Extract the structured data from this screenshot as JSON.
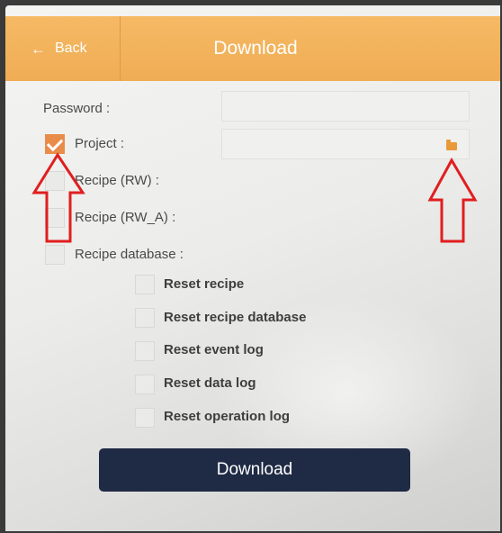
{
  "header": {
    "back_label": "Back",
    "back_icon": "arrow-left-icon",
    "title": "Download"
  },
  "form": {
    "password_label": "Password :",
    "password_value": "",
    "project_label": "Project :",
    "project_checked": true,
    "project_path": "",
    "project_icon": "folder-icon",
    "options": [
      {
        "label": "Recipe (RW) :",
        "checked": false
      },
      {
        "label": "Recipe (RW_A) :",
        "checked": false
      },
      {
        "label": "Recipe database :",
        "checked": false
      }
    ],
    "reset_options": [
      {
        "label": "Reset recipe",
        "checked": false
      },
      {
        "label": "Reset recipe database",
        "checked": false
      },
      {
        "label": "Reset event log",
        "checked": false
      },
      {
        "label": "Reset data log",
        "checked": false
      },
      {
        "label": "Reset operation log",
        "checked": false
      }
    ]
  },
  "actions": {
    "download_label": "Download"
  },
  "colors": {
    "header": "#f0ae57",
    "checked": "#e98c4a",
    "button": "#1f2a44",
    "annotation": "#e01e1e"
  }
}
